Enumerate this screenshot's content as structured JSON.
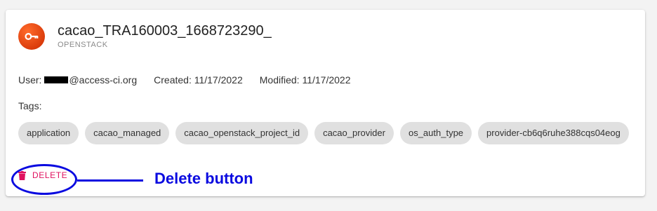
{
  "card": {
    "title": "cacao_TRA160003_1668723290_",
    "subtitle": "OPENSTACK",
    "avatar_icon": "key-icon",
    "avatar_color": "#e8400c",
    "meta": {
      "user_label": "User:",
      "user_email_suffix": "@access-ci.org",
      "created": "Created: 11/17/2022",
      "modified": "Modified: 11/17/2022"
    },
    "tags_label": "Tags:",
    "tags": [
      "application",
      "cacao_managed",
      "cacao_openstack_project_id",
      "cacao_provider",
      "os_auth_type",
      "provider-cb6q6ruhe388cqs04eog"
    ],
    "delete_label": "DELETE",
    "delete_icon": "trash-icon",
    "delete_color": "#e0115f"
  },
  "annotation": {
    "label": "Delete button",
    "color": "#0a0ae0"
  }
}
